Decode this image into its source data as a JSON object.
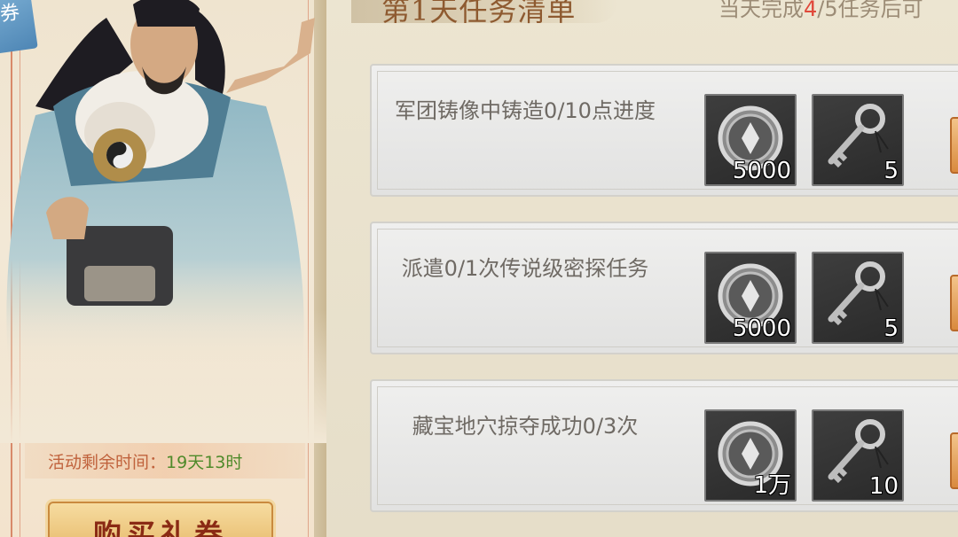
{
  "promo": {
    "corner_tag": "券",
    "timer_label": "活动剩余时间：",
    "timer_value": "19天13时",
    "buy_button": "购买礼券"
  },
  "tasks_header": {
    "day_title": "第1天任务清单",
    "progress_prefix": "当天完成",
    "progress_done": "4",
    "progress_suffix": "/5任务后可"
  },
  "tasks": [
    {
      "description": "军团铸像中铸造0/10点进度",
      "rewards": [
        {
          "icon": "coin-icon",
          "count": "5000"
        },
        {
          "icon": "key-icon",
          "count": "5"
        }
      ]
    },
    {
      "description": "派遣0/1次传说级密探任务",
      "rewards": [
        {
          "icon": "coin-icon",
          "count": "5000"
        },
        {
          "icon": "key-icon",
          "count": "5"
        }
      ]
    },
    {
      "description": "藏宝地穴掠夺成功0/3次",
      "rewards": [
        {
          "icon": "coin-icon",
          "count": "1万"
        },
        {
          "icon": "key-icon",
          "count": "10"
        }
      ]
    }
  ],
  "colors": {
    "accent_red": "#e0483a",
    "timer_green": "#4e8a2a",
    "title_brown": "#8e5a30"
  }
}
